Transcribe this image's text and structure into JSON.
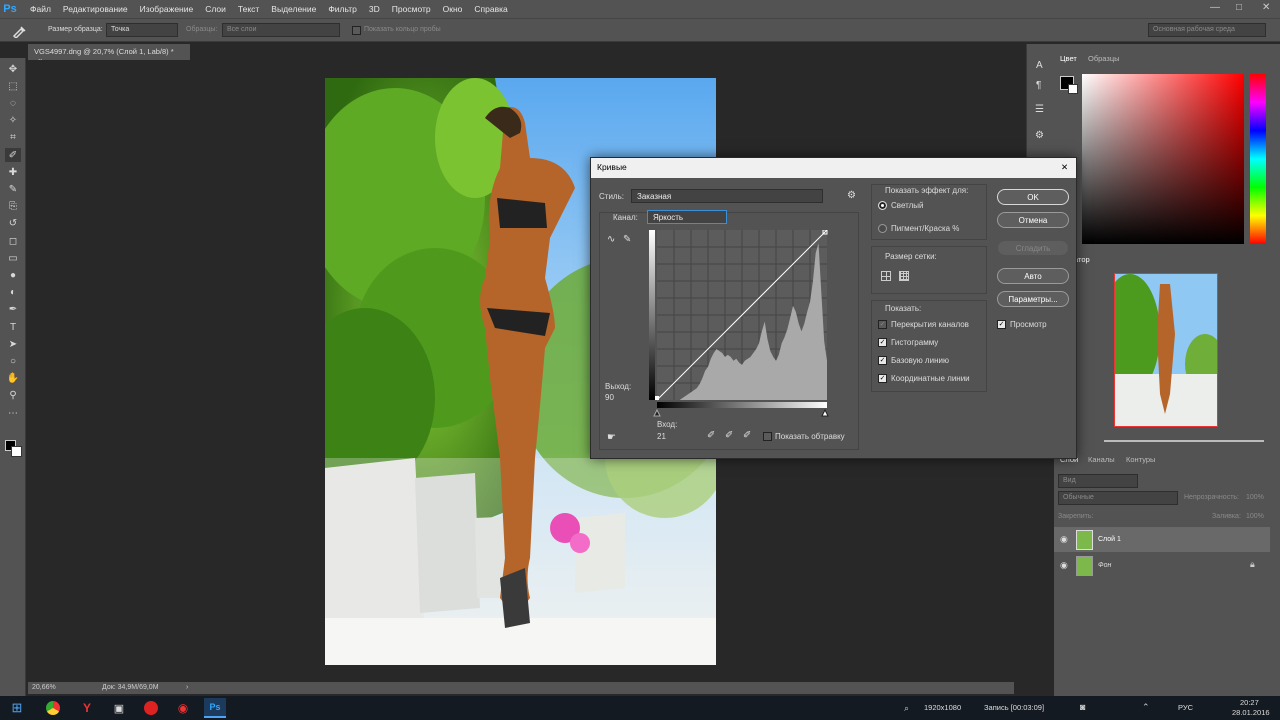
{
  "app": {
    "logo": "Ps",
    "minimize": "—",
    "maximize": "□",
    "close": "✕"
  },
  "menu": [
    "Файл",
    "Редактирование",
    "Изображение",
    "Слои",
    "Текст",
    "Выделение",
    "Фильтр",
    "3D",
    "Просмотр",
    "Окно",
    "Справка"
  ],
  "options": {
    "sample_size_label": "Размер образца:",
    "sample_size_value": "Точка",
    "samples_label": "Образцы:",
    "samples_value": "Все слои",
    "show_ring": "Показать кольцо пробы",
    "workspace": "Основная рабочая среда"
  },
  "document": {
    "tab": "VGS4997.dng @ 20,7% (Слой 1, Lab/8) *",
    "close": "×"
  },
  "status": {
    "zoom": "20,66%",
    "doc": "Док: 34,9M/69,0M",
    "arrow": "›"
  },
  "curves": {
    "title": "Кривые",
    "close": "✕",
    "style_label": "Стиль:",
    "style_value": "Заказная",
    "channel_label": "Канал:",
    "channel_value": "Яркость",
    "output_label": "Выход:",
    "output_value": "90",
    "input_label": "Вход:",
    "input_value": "21",
    "show_clipping": "Показать обтравку",
    "show_effect_for": "Показать эффект для:",
    "light": "Светлый",
    "pigment": "Пигмент/Краска %",
    "grid_size": "Размер сетки:",
    "show": "Показать:",
    "overlays": "Перекрытия каналов",
    "histogram": "Гистограмму",
    "baseline": "Базовую линию",
    "intersection": "Координатные линии",
    "buttons": {
      "ok": "OK",
      "cancel": "Отмена",
      "smooth": "Сгладить",
      "auto": "Авто",
      "options": "Параметры...",
      "preview": "Просмотр"
    },
    "curve_points": [
      [
        0,
        0
      ],
      [
        255,
        255
      ]
    ]
  },
  "panels": {
    "color_tab": "Цвет",
    "swatches_tab": "Образцы",
    "navigator_tab": "Навигатор",
    "navigator_visible": "атор",
    "layers_tab": "Слои",
    "channels_tab": "Каналы",
    "paths_tab": "Контуры",
    "filter_kind": "Вид",
    "blend_mode": "Обычные",
    "opacity_label": "Непрозрачность:",
    "opacity_value": "100%",
    "lock_label": "Закрепить:",
    "fill_label": "Заливка:",
    "fill_value": "100%",
    "layers": [
      {
        "name": "Слой 1",
        "selected": true
      },
      {
        "name": "Фон",
        "selected": false,
        "locked": true
      }
    ]
  },
  "taskbar": {
    "resolution": "1920x1080",
    "recording": "Запись [00:03:09]",
    "lang": "РУС",
    "time": "20:27",
    "date": "28.01.2016"
  },
  "colors": {
    "accent": "#31a8ff",
    "panel": "#535353",
    "dark": "#282828",
    "sky": "#6cb8f0",
    "foliage": "#3d8a1a"
  }
}
